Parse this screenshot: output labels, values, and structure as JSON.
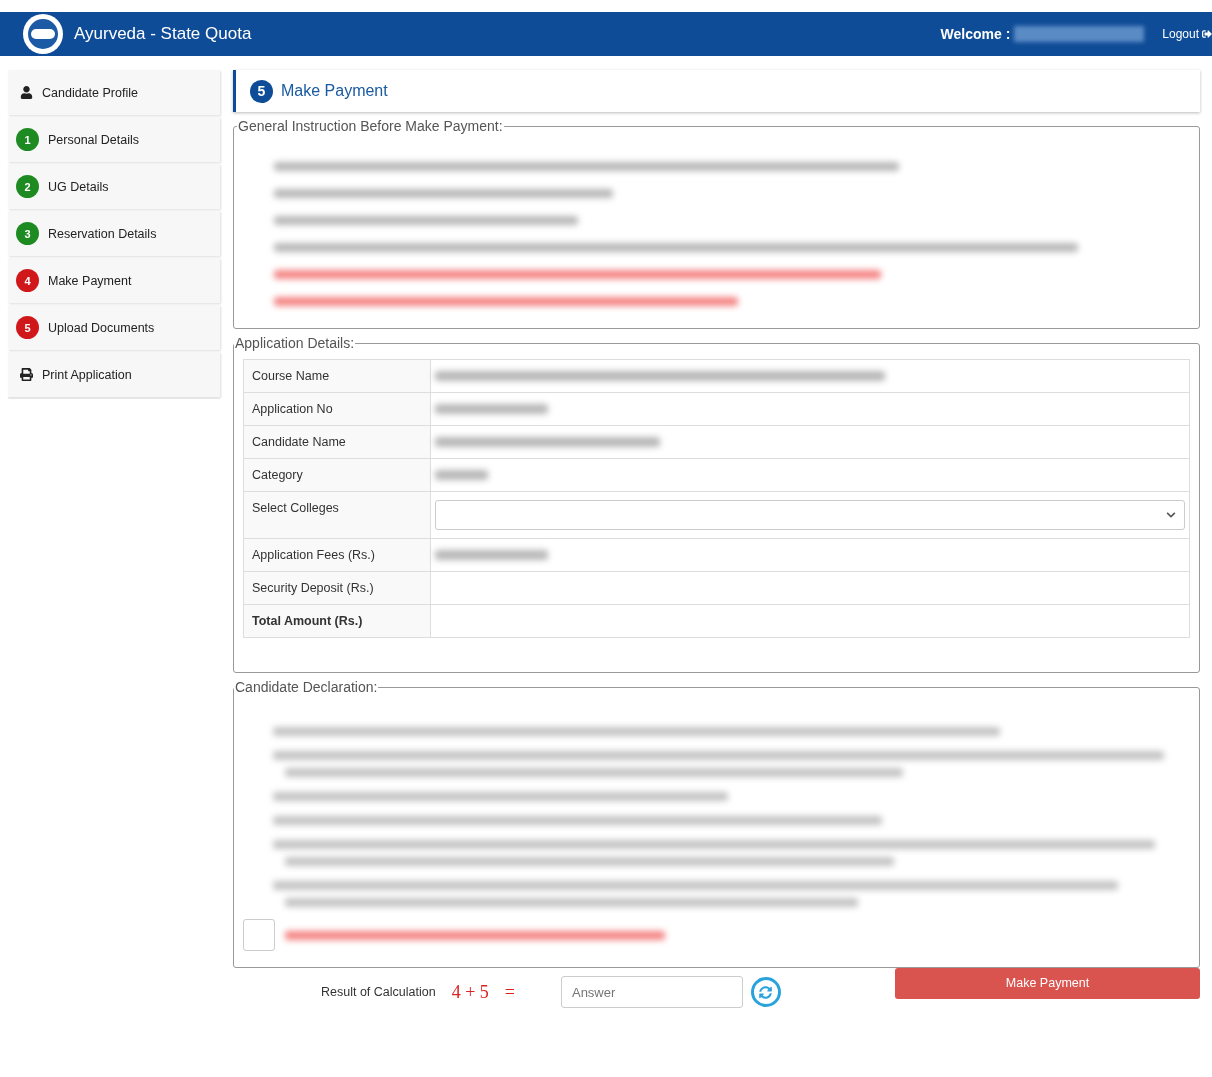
{
  "header": {
    "title": "Ayurveda - State Quota",
    "welcome": "Welcome :",
    "logout": "Logout"
  },
  "sidebar": [
    {
      "kind": "link",
      "label": "Candidate Profile"
    },
    {
      "kind": "step",
      "number": "1",
      "label": "Personal Details",
      "done": true
    },
    {
      "kind": "step",
      "number": "2",
      "label": "UG Details",
      "done": true
    },
    {
      "kind": "step",
      "number": "3",
      "label": "Reservation Details",
      "done": true
    },
    {
      "kind": "step",
      "number": "4",
      "label": "Make Payment",
      "done": false
    },
    {
      "kind": "step",
      "number": "5",
      "label": "Upload Documents",
      "done": false
    },
    {
      "kind": "link",
      "label": "Print Application"
    }
  ],
  "page_heading": {
    "number": "5",
    "title": "Make Payment"
  },
  "instructions": {
    "legend": "General Instruction Before Make Payment:"
  },
  "application": {
    "legend": "Application Details:",
    "rows": [
      {
        "kind": "text",
        "label": "Course Name",
        "bold": false
      },
      {
        "kind": "text",
        "label": "Application No",
        "bold": false
      },
      {
        "kind": "text",
        "label": "Candidate Name",
        "bold": false
      },
      {
        "kind": "text",
        "label": "Category",
        "bold": false
      },
      {
        "kind": "select",
        "label": "Select Colleges",
        "bold": false
      },
      {
        "kind": "text",
        "label": "Application Fees (Rs.)",
        "bold": false
      },
      {
        "kind": "text",
        "label": "Security Deposit (Rs.)",
        "bold": false
      },
      {
        "kind": "text",
        "label": "Total Amount (Rs.)",
        "bold": true
      }
    ]
  },
  "declaration": {
    "legend": "Candidate Declaration:",
    "checkbox_checked": false
  },
  "captcha": {
    "label": "Result of Calculation",
    "expression": "4 + 5",
    "equals": "=",
    "placeholder": "Answer"
  },
  "submit": "Make Payment"
}
